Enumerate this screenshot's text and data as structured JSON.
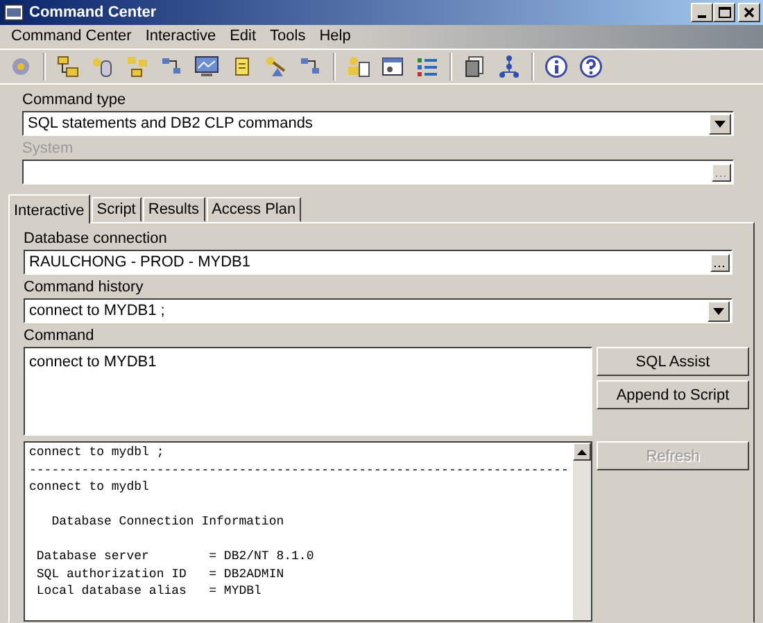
{
  "window": {
    "title": "Command Center"
  },
  "menu": [
    "Command Center",
    "Interactive",
    "Edit",
    "Tools",
    "Help"
  ],
  "command_type": {
    "label": "Command type",
    "value": "SQL statements and DB2 CLP commands"
  },
  "system": {
    "label": "System",
    "disabled": true
  },
  "tabs": [
    {
      "label": "Interactive",
      "selected": true
    },
    {
      "label": "Script",
      "selected": false
    },
    {
      "label": "Results",
      "selected": false
    },
    {
      "label": "Access Plan",
      "selected": false
    }
  ],
  "database_connection": {
    "label": "Database connection",
    "value": "RAULCHONG - PROD - MYDB1"
  },
  "command_history": {
    "label": "Command history",
    "value": "connect to MYDB1 ;"
  },
  "command": {
    "label": "Command",
    "value": "connect to MYDB1"
  },
  "buttons": [
    {
      "label": "SQL Assist",
      "disabled": false
    },
    {
      "label": "Append to Script",
      "disabled": false
    }
  ],
  "output": {
    "blocks": [
      [
        "connect to mydbl ;",
        "------------------------------------------------------------------------",
        "connect to mydbl"
      ],
      [
        "   Database Connection Information"
      ],
      [
        " Database server        = DB2/NT 8.1.0",
        " SQL authorization ID   = DB2ADMIN",
        " Local database alias   = MYDBl"
      ]
    ]
  },
  "refresh_button": {
    "label": "Refresh",
    "disabled": true
  }
}
